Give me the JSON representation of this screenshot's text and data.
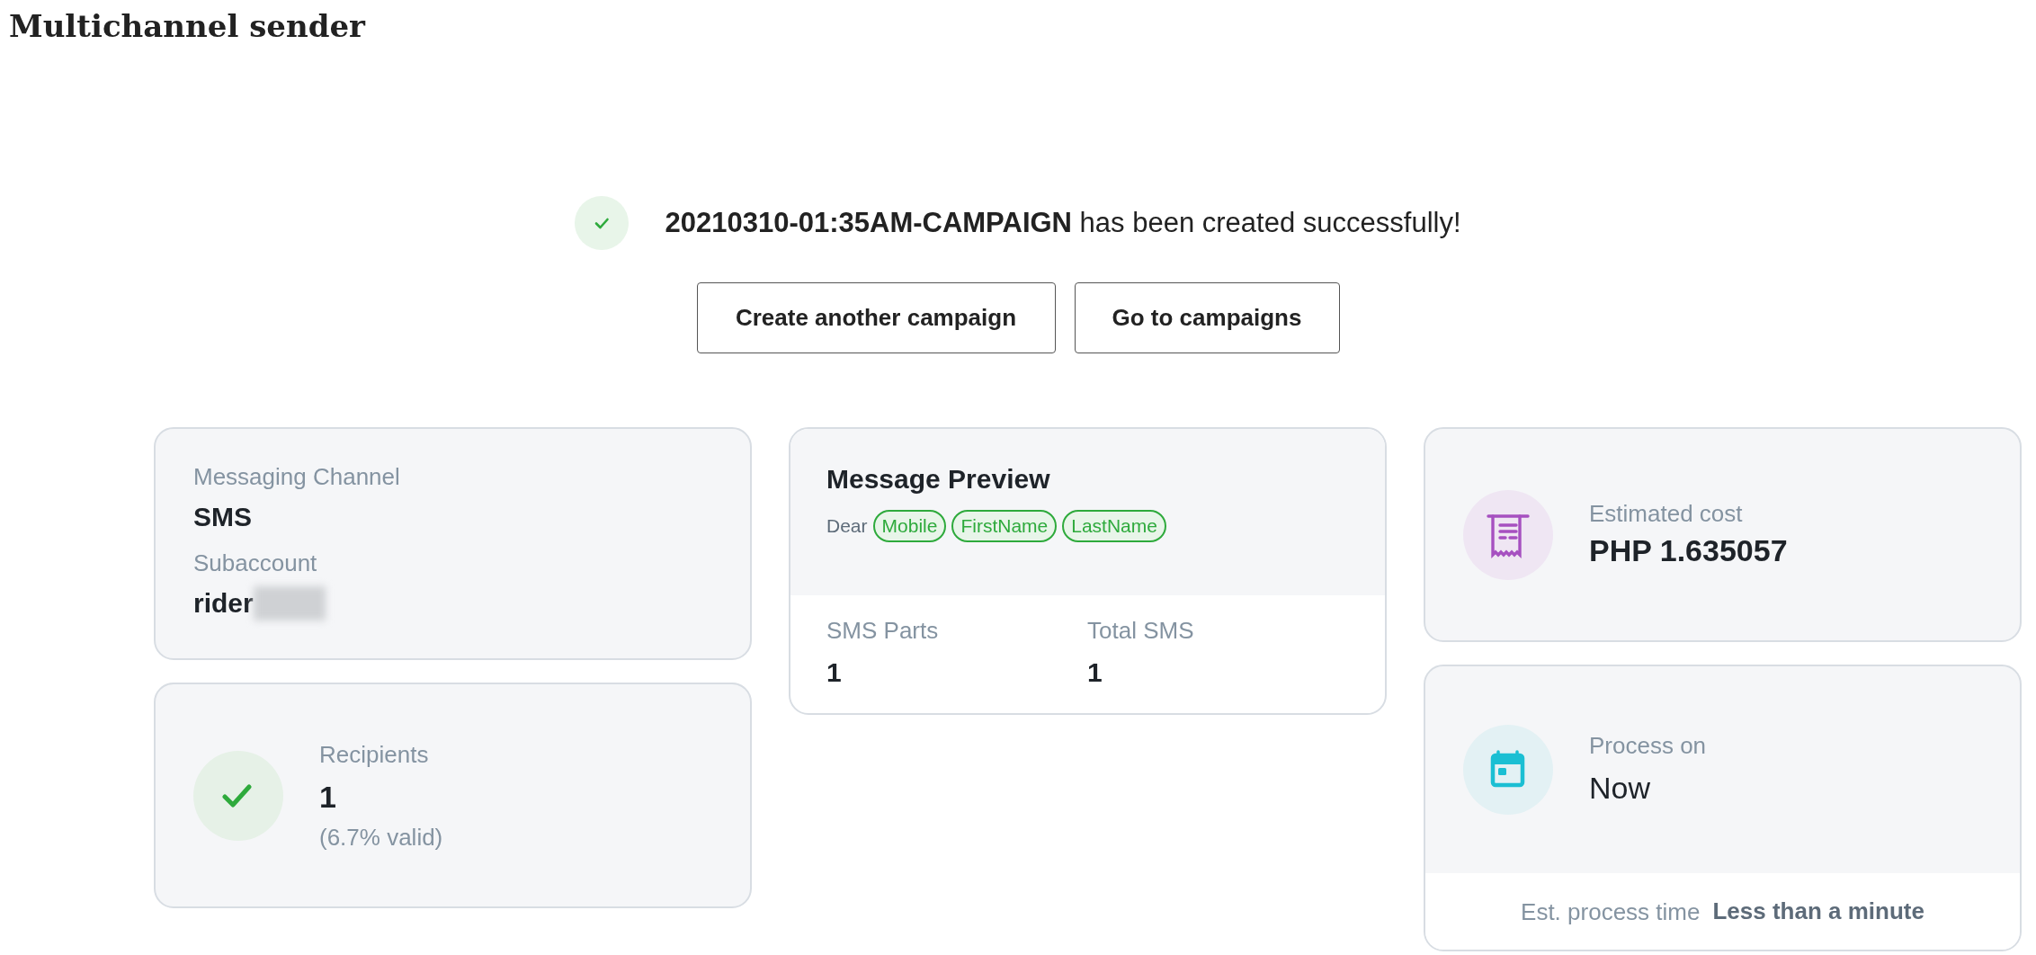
{
  "page_title": "Multichannel sender",
  "notice": {
    "message": "**20210310-01:35AM-CAMPAIGN** has been created successfully!"
  },
  "actions": [
    "Create another campaign",
    "Go to campaigns"
  ],
  "channel_card": {
    "fields": [
      {
        "label": "Messaging Channel",
        "value": "SMS",
        "redacted": false
      },
      {
        "label": "Subaccount",
        "value": "rider",
        "redacted": true
      }
    ]
  },
  "recipients_card": {
    "label": "Recipients",
    "value": "1",
    "note": "(6.7% valid)"
  },
  "preview_card": {
    "title": "Message Preview",
    "greeting": "Dear",
    "tags": [
      "Mobile",
      "FirstName",
      "LastName"
    ],
    "stats": [
      {
        "label": "SMS Parts",
        "value": "1"
      },
      {
        "label": "Total SMS",
        "value": "1"
      }
    ]
  },
  "cost_card": {
    "label": "Estimated cost",
    "value": "PHP 1.635057"
  },
  "schedule_card": {
    "label": "Process on",
    "value": "Now",
    "footer_label": "Est. process time",
    "footer_value": "Less than a minute"
  }
}
